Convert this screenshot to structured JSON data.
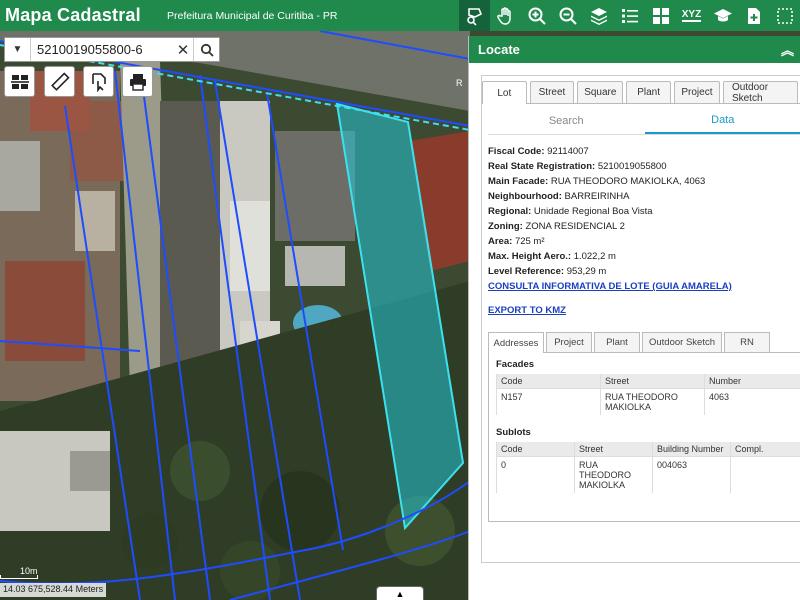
{
  "header": {
    "title": "Mapa Cadastral",
    "subtitle": "Prefeitura Municipal de Curitiba - PR",
    "tools": [
      "locate-parcel-icon",
      "pan-hand-icon",
      "zoom-in-icon",
      "zoom-out-icon",
      "layers-icon",
      "legend-list-icon",
      "basemap-grid-icon",
      "xyz-coordinates-icon",
      "graduation-cap-icon",
      "add-document-icon",
      "select-area-icon"
    ],
    "xyz_label": "XYZ"
  },
  "search": {
    "value": "5210019055800-6",
    "clear_glyph": "✕"
  },
  "map": {
    "street_label": "R",
    "scale_label": "10m",
    "coordinates": "14.03 675,528.44 Meters"
  },
  "panel": {
    "title": "Locate",
    "tabs": [
      "Lot",
      "Street",
      "Square",
      "Plant",
      "Project",
      "Outdoor Sketch"
    ],
    "segments": [
      "Search",
      "Data"
    ],
    "fields": [
      {
        "label": "Fiscal Code:",
        "value": "92114007"
      },
      {
        "label": "Real State Registration:",
        "value": "5210019055800"
      },
      {
        "label": "Main Facade:",
        "value": "RUA THEODORO MAKIOLKA, 4063"
      },
      {
        "label": "Neighbourhood:",
        "value": "BARREIRINHA"
      },
      {
        "label": "Regional:",
        "value": "Unidade Regional Boa Vista"
      },
      {
        "label": "Zoning:",
        "value": "ZONA RESIDENCIAL 2"
      },
      {
        "label": "Area:",
        "value": "725 m²"
      },
      {
        "label": "Max. Height Aero.:",
        "value": "1.022,2 m"
      },
      {
        "label": "Level Reference:",
        "value": "953,29 m"
      }
    ],
    "link_consulta": "CONSULTA INFORMATIVA DE LOTE (GUIA AMARELA)",
    "link_export": "EXPORT TO KMZ",
    "subtabs": [
      "Addresses",
      "Project",
      "Plant",
      "Outdoor Sketch",
      "RN"
    ],
    "facades": {
      "title": "Facades",
      "headers": [
        "Code",
        "Street",
        "Number"
      ],
      "rows": [
        [
          "N157",
          "RUA THEODORO MAKIOLKA",
          "4063"
        ]
      ]
    },
    "sublots": {
      "title": "Sublots",
      "headers": [
        "Code",
        "Street",
        "Building Number",
        "Compl."
      ],
      "rows": [
        [
          "0",
          "RUA THEODORO MAKIOLKA",
          "004063",
          ""
        ]
      ]
    }
  },
  "colors": {
    "brand_green": "#1f8a4c",
    "parcel_highlight": "#22c6d6",
    "lot_lines": "#1e4dff",
    "link": "#1a3fbf",
    "active_tab": "#1a9acb"
  }
}
